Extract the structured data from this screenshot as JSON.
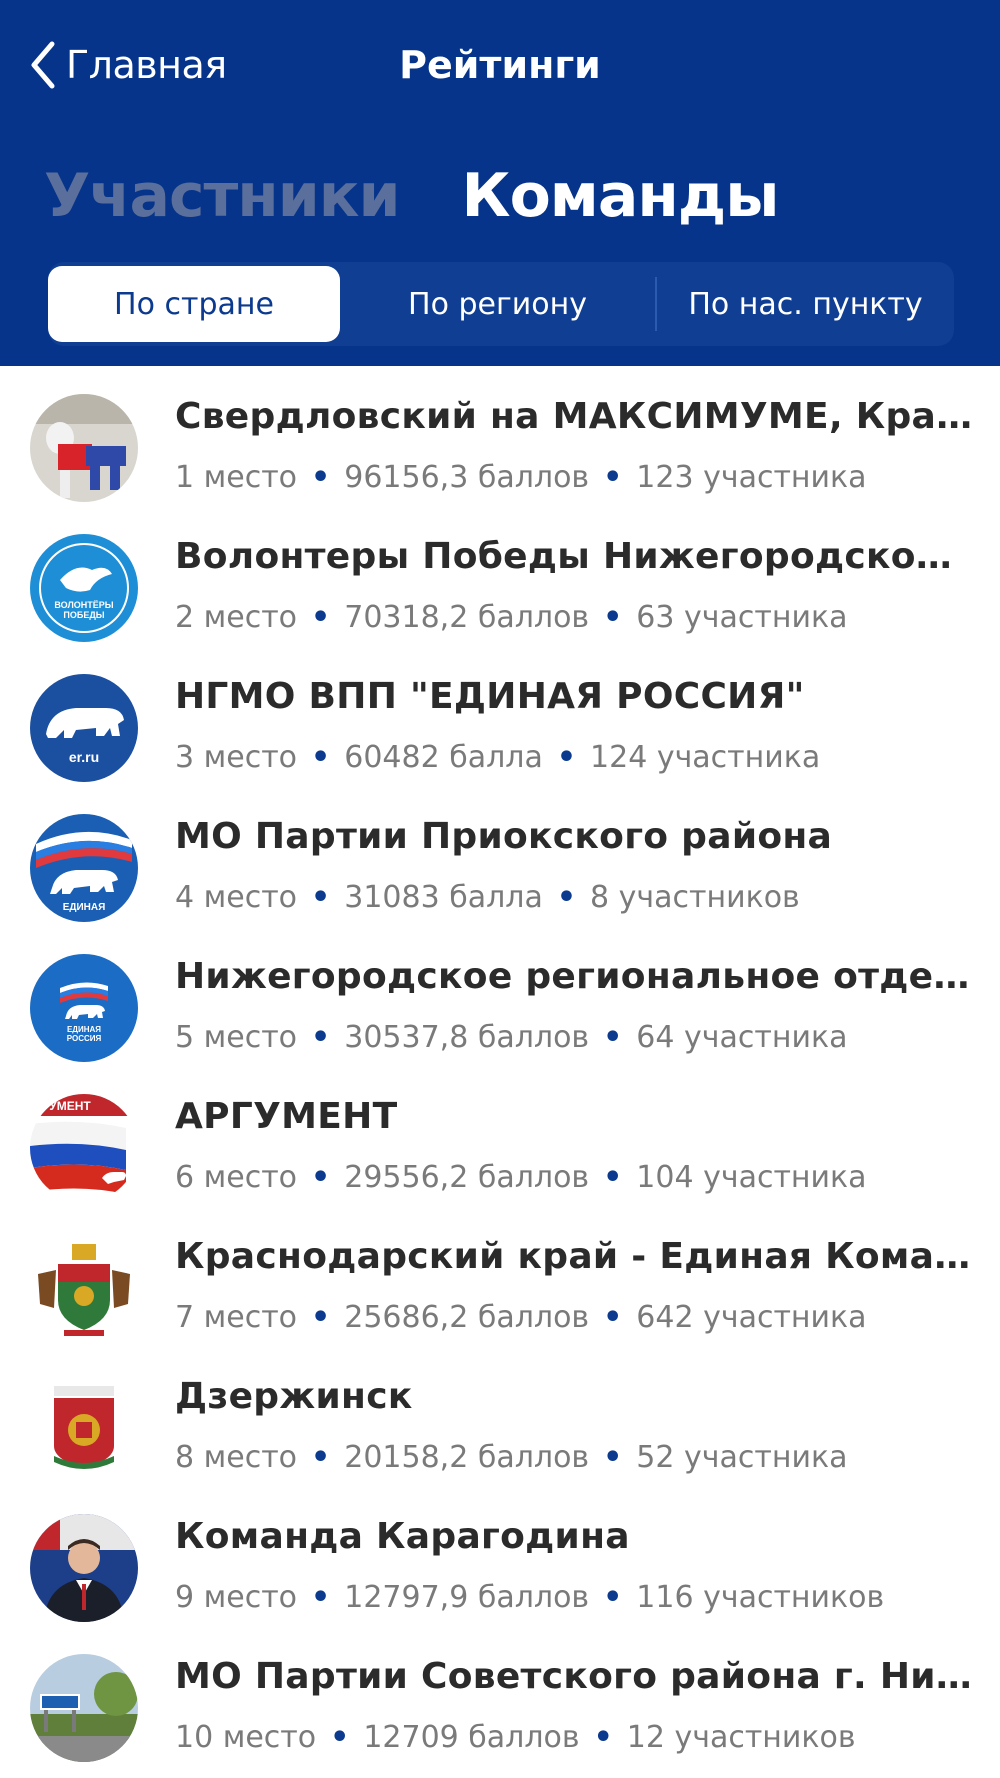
{
  "header": {
    "back_label": "Главная",
    "title": "Рейтинги",
    "segments": [
      "Участники",
      "Команды"
    ],
    "tabs": [
      "По стране",
      "По региону",
      "По нас. пункту"
    ]
  },
  "teams": [
    {
      "name": "Свердловский на МАКСИМУМЕ, Красно…",
      "place": "1 место",
      "points": "96156,3 баллов",
      "members": "123 участника",
      "avatar": "photo-avatar"
    },
    {
      "name": "Волонтеры Победы Нижегородской об…",
      "place": "2 место",
      "points": "70318,2 баллов",
      "members": "63 участника",
      "avatar": "volunteers-logo"
    },
    {
      "name": "НГМО ВПП \"ЕДИНАЯ РОССИЯ\"",
      "place": "3 место",
      "points": "60482 балла",
      "members": "124 участника",
      "avatar": "bear-logo"
    },
    {
      "name": "МО Партии Приокского района",
      "place": "4 место",
      "points": "31083 балла",
      "members": "8 участников",
      "avatar": "united-russia-logo"
    },
    {
      "name": "Нижегородское региональное отделен…",
      "place": "5 место",
      "points": "30537,8 баллов",
      "members": "64 участника",
      "avatar": "united-russia-logo"
    },
    {
      "name": "АРГУМЕНТ",
      "place": "6 место",
      "points": "29556,2 баллов",
      "members": "104 участника",
      "avatar": "flag-logo"
    },
    {
      "name": "Краснодарский край - Единая Команда",
      "place": "7 место",
      "points": "25686,2 баллов",
      "members": "642 участника",
      "avatar": "coat-of-arms"
    },
    {
      "name": "Дзержинск",
      "place": "8 место",
      "points": "20158,2 баллов",
      "members": "52 участника",
      "avatar": "city-emblem"
    },
    {
      "name": "Команда Карагодина",
      "place": "9 место",
      "points": "12797,9 баллов",
      "members": "116 участников",
      "avatar": "person-photo"
    },
    {
      "name": "МО Партии Советского района г. Нижн…",
      "place": "10 место",
      "points": "12709 баллов",
      "members": "12 участников",
      "avatar": "street-photo"
    }
  ]
}
